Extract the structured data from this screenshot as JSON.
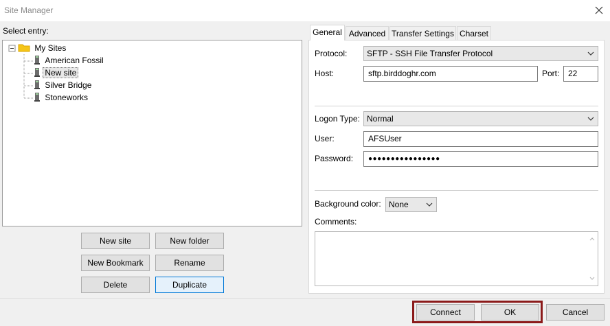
{
  "window": {
    "title": "Site Manager"
  },
  "left": {
    "select_entry_label": "Select entry:",
    "tree": {
      "root": "My Sites",
      "items": [
        "American Fossil",
        "New site",
        "Silver Bridge",
        "Stoneworks"
      ],
      "selected": "New site"
    },
    "buttons": {
      "new_site": "New site",
      "new_folder": "New folder",
      "new_bookmark": "New Bookmark",
      "rename": "Rename",
      "delete": "Delete",
      "duplicate": "Duplicate"
    }
  },
  "tabs": [
    "General",
    "Advanced",
    "Transfer Settings",
    "Charset"
  ],
  "general": {
    "protocol_label": "Protocol:",
    "protocol_value": "SFTP - SSH File Transfer Protocol",
    "host_label": "Host:",
    "host_value": "sftp.birddoghr.com",
    "port_label": "Port:",
    "port_value": "22",
    "logon_type_label": "Logon Type:",
    "logon_type_value": "Normal",
    "user_label": "User:",
    "user_value": "AFSUser",
    "password_label": "Password:",
    "password_value": "●●●●●●●●●●●●●●●●",
    "bg_color_label": "Background color:",
    "bg_color_value": "None",
    "comments_label": "Comments:"
  },
  "footer": {
    "connect": "Connect",
    "ok": "OK",
    "cancel": "Cancel"
  },
  "colors": {
    "highlight": "#8b1a1a",
    "focus": "#0078d7"
  }
}
